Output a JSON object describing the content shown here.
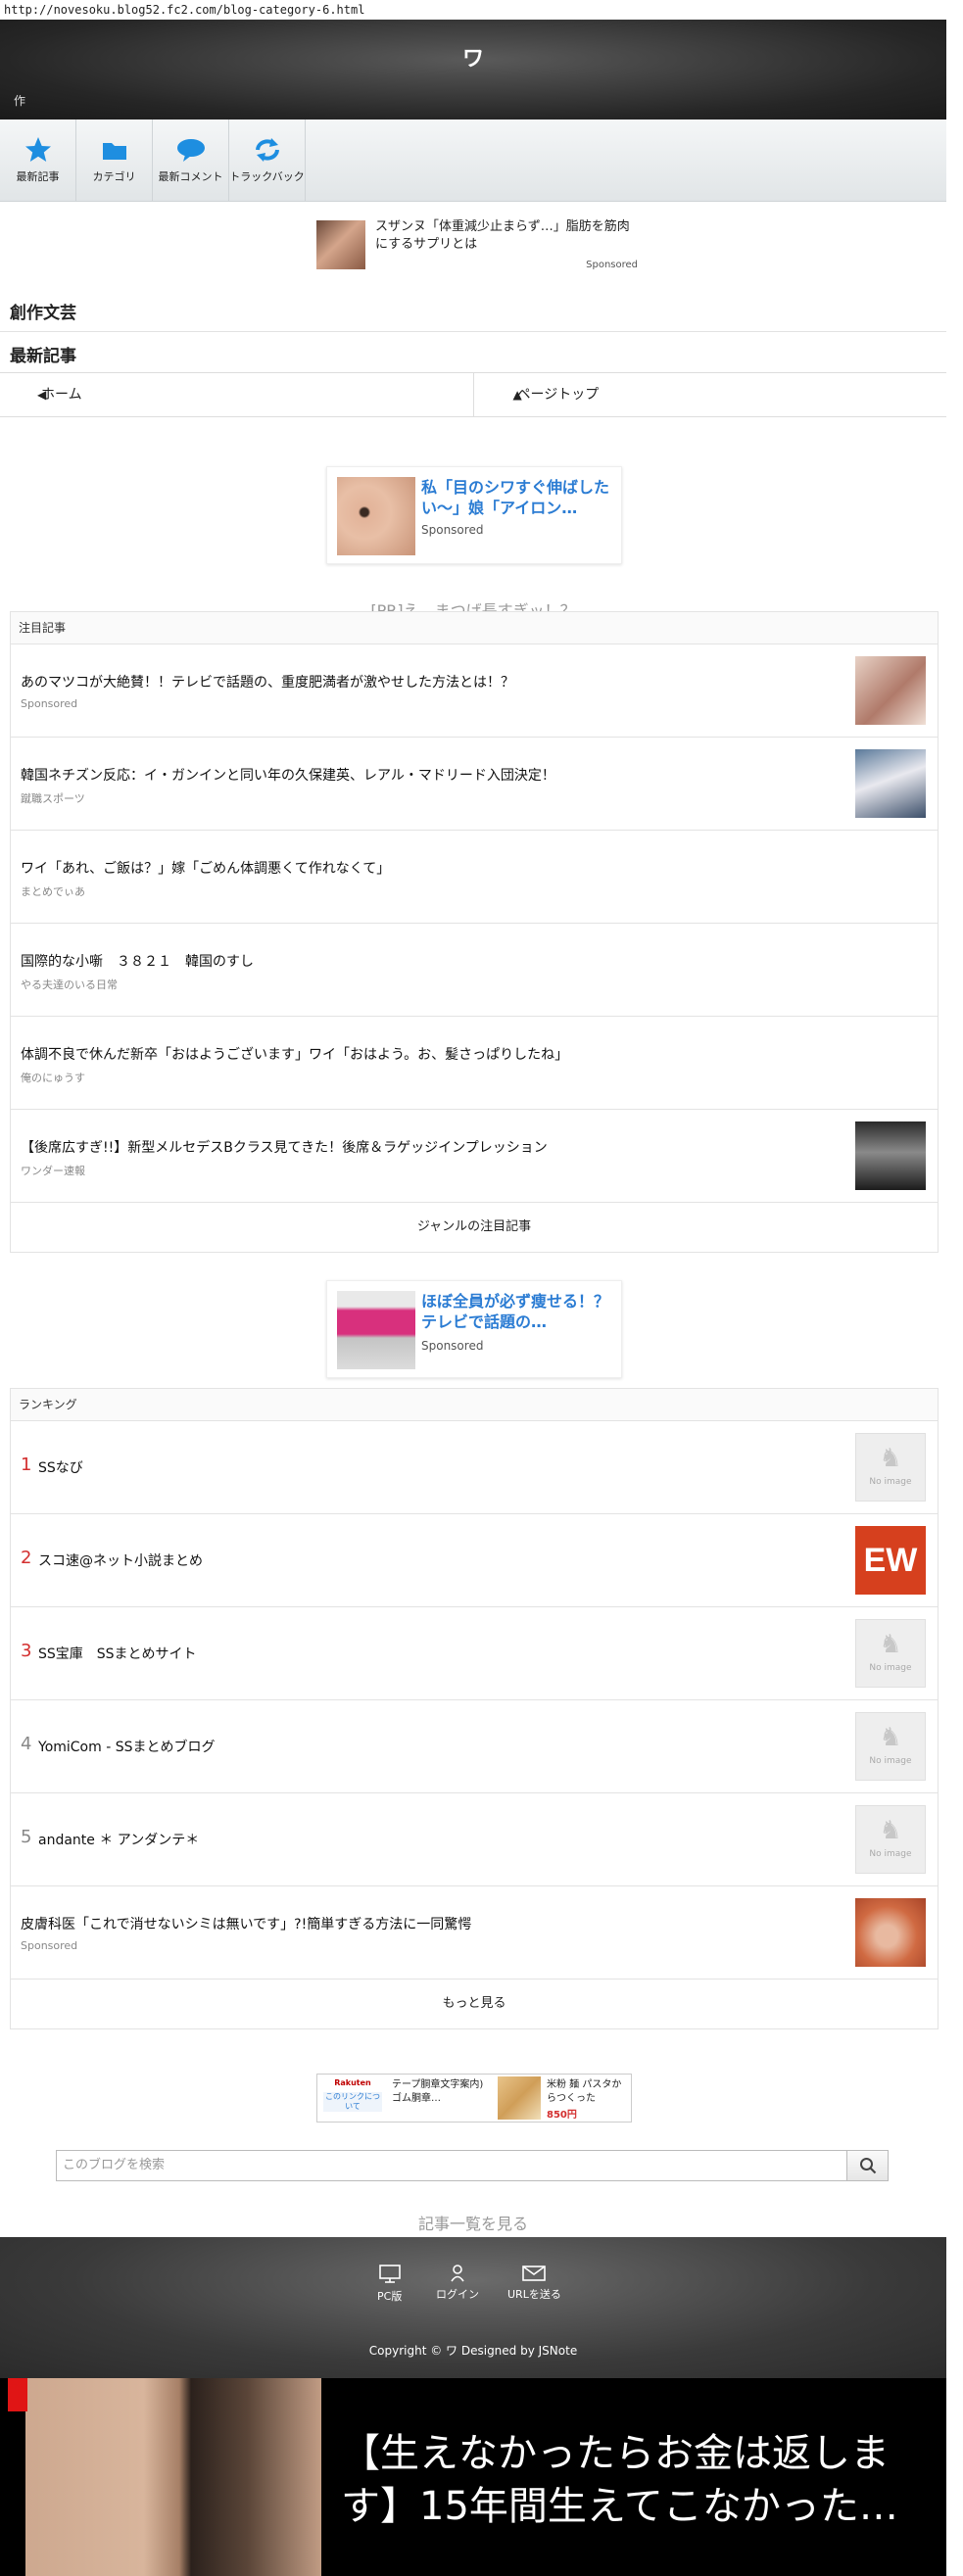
{
  "browser": {
    "url": "http://novesoku.blog52.fc2.com/blog-category-6.html"
  },
  "header": {
    "title": "ワ",
    "subtitle": "作"
  },
  "nav": [
    {
      "label": "最新記事",
      "icon": "star-icon"
    },
    {
      "label": "カテゴリ",
      "icon": "folder-icon"
    },
    {
      "label": "最新コメント",
      "icon": "comment-icon"
    },
    {
      "label": "トラックバック",
      "icon": "trackback-icon"
    }
  ],
  "top_ad": {
    "text": "スザンヌ「体重減少止まらず…」脂肪を筋肉にするサプリとは",
    "sponsored": "Sponsored"
  },
  "category_title": "創作文芸",
  "latest_title": "最新記事",
  "bar": {
    "home": "ホーム",
    "pagetop": "ページトップ"
  },
  "ad_mid_1": {
    "title": "私「目のシワすぐ伸ばしたい〜」娘「アイロン…",
    "sponsored": "Sponsored"
  },
  "pr_text": "[PR]え、まつげ長すぎッ！？",
  "featured": {
    "header": "注目記事",
    "items": [
      {
        "title": "あのマツコが大絶賛！！テレビで話題の、重度肥満者が激やせした方法とは！？",
        "source": "Sponsored"
      },
      {
        "title": "韓国ネチズン反応：イ・ガンインと同い年の久保建英、レアル・マドリード入団決定！",
        "source": "蹴職スポーツ"
      },
      {
        "title": "ワイ「あれ、ご飯は？」嫁「ごめん体調悪くて作れなくて」",
        "source": "まとめでぃあ"
      },
      {
        "title": "国際的な小噺　３８２１　韓国のすし",
        "source": "やる夫達のいる日常"
      },
      {
        "title": "体調不良で休んだ新卒「おはようございます」ワイ「おはよう。お、髪さっぱりしたね」",
        "source": "俺のにゅうす"
      },
      {
        "title": "【後席広すぎ!!】新型メルセデスBクラス見てきた！後席＆ラゲッジインプレッション",
        "source": "ワンダー速報"
      }
    ],
    "footer": "ジャンルの注目記事"
  },
  "ad_mid_2": {
    "title": "ほぼ全員が必ず痩せる！？テレビで話題の…",
    "sponsored": "Sponsored"
  },
  "ranking": {
    "header": "ランキング",
    "items": [
      {
        "rank": "1",
        "title": "SSなび",
        "thumb": "No image"
      },
      {
        "rank": "2",
        "title": "スコ速@ネット小説まとめ",
        "thumb": "EW"
      },
      {
        "rank": "3",
        "title": "SS宝庫　SSまとめサイト",
        "thumb": "No image"
      },
      {
        "rank": "4",
        "title": "YomiCom - SSまとめブログ",
        "thumb": "No image"
      },
      {
        "rank": "5",
        "title": "andante ＊ アンダンテ＊",
        "thumb": "No image"
      }
    ],
    "sponsored_item": {
      "title": "皮膚科医「これで消せないシミは無いです」?!簡単すぎる方法に一同驚愕",
      "source": "Sponsored"
    },
    "footer": "もっと見る"
  },
  "bottom_ad": {
    "rakuten_label": "Rakuten",
    "about_link": "このリンクについて",
    "product1": "テープ胴章文字案内)ゴム胴章…",
    "product2": "米粉 麺 パスタからつくった",
    "price": "850円"
  },
  "search": {
    "placeholder": "このブログを検索"
  },
  "all_articles": "記事一覧を見る",
  "footer": {
    "pc": "PC版",
    "login": "ログイン",
    "send_url": "URLを送る",
    "copyright": "Copyright © ワ  Designed by JSNote"
  },
  "banner": {
    "text": "【生えなかったらお金は返します】15年間生えてこなかった…"
  }
}
